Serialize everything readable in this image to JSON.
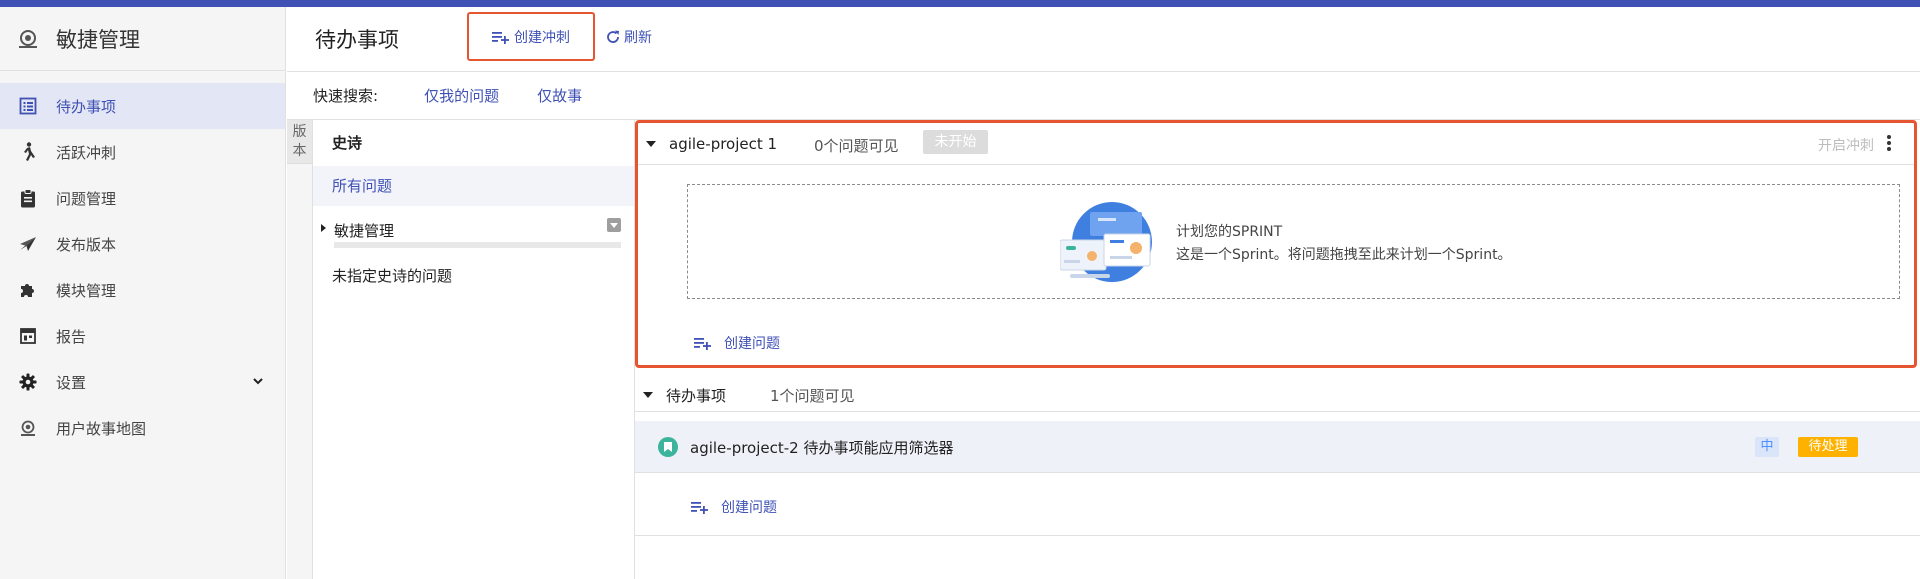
{
  "colors": {
    "accent": "#3f51b5",
    "highlight": "#e5552f",
    "status_todo": "#ffb100",
    "story_icon": "#3cb49c"
  },
  "sidebar": {
    "title": "敏捷管理",
    "items": [
      {
        "label": "待办事项",
        "icon": "backlog-icon"
      },
      {
        "label": "活跃冲刺",
        "icon": "running-icon"
      },
      {
        "label": "问题管理",
        "icon": "clipboard-icon"
      },
      {
        "label": "发布版本",
        "icon": "send-icon"
      },
      {
        "label": "模块管理",
        "icon": "puzzle-icon"
      },
      {
        "label": "报告",
        "icon": "report-icon"
      },
      {
        "label": "设置",
        "icon": "gear-icon"
      },
      {
        "label": "用户故事地图",
        "icon": "story-map-icon"
      }
    ]
  },
  "header": {
    "title": "待办事项",
    "create_sprint": "创建冲刺",
    "refresh": "刷新"
  },
  "quick_search": {
    "label": "快速搜索:",
    "only_mine": "仅我的问题",
    "only_story": "仅故事"
  },
  "version_tab": {
    "line1": "版",
    "line2": "本"
  },
  "epic_panel": {
    "title": "史诗",
    "all_issues": "所有问题",
    "epics": [
      {
        "name": "敏捷管理"
      }
    ],
    "unassigned": "未指定史诗的问题"
  },
  "sprint": {
    "name": "agile-project 1",
    "count": "0个问题可见",
    "status": "未开始",
    "start": "开启冲刺",
    "plan_title": "计划您的SPRINT",
    "plan_desc": "这是一个Sprint。将问题拖拽至此来计划一个Sprint。",
    "create_issue": "创建问题"
  },
  "backlog": {
    "name": "待办事项",
    "count": "1个问题可见",
    "issues": [
      {
        "title": "agile-project-2 待办事项能应用筛选器",
        "priority": "中",
        "status": "待处理"
      }
    ],
    "create_issue": "创建问题"
  }
}
